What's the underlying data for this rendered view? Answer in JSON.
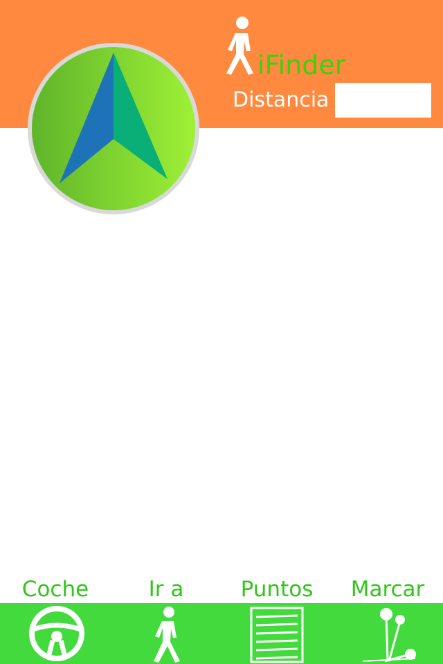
{
  "app": {
    "title": "iFinder",
    "distance_label": "Distancia",
    "distance_value": ""
  },
  "toolbar": {
    "items": [
      {
        "label": "Coche",
        "icon": "steering-wheel-icon"
      },
      {
        "label": "Ir a",
        "icon": "walking-person-icon"
      },
      {
        "label": "Puntos",
        "icon": "list-sheet-icon"
      },
      {
        "label": "Marcar",
        "icon": "pins-icon"
      }
    ]
  },
  "colors": {
    "header": "#ff8a3f",
    "toolbar": "#43da3e",
    "label_green": "#32c51a",
    "compass_green": "#7ed93a",
    "arrow_blue": "#1e73b8",
    "arrow_teal": "#0aae77"
  }
}
